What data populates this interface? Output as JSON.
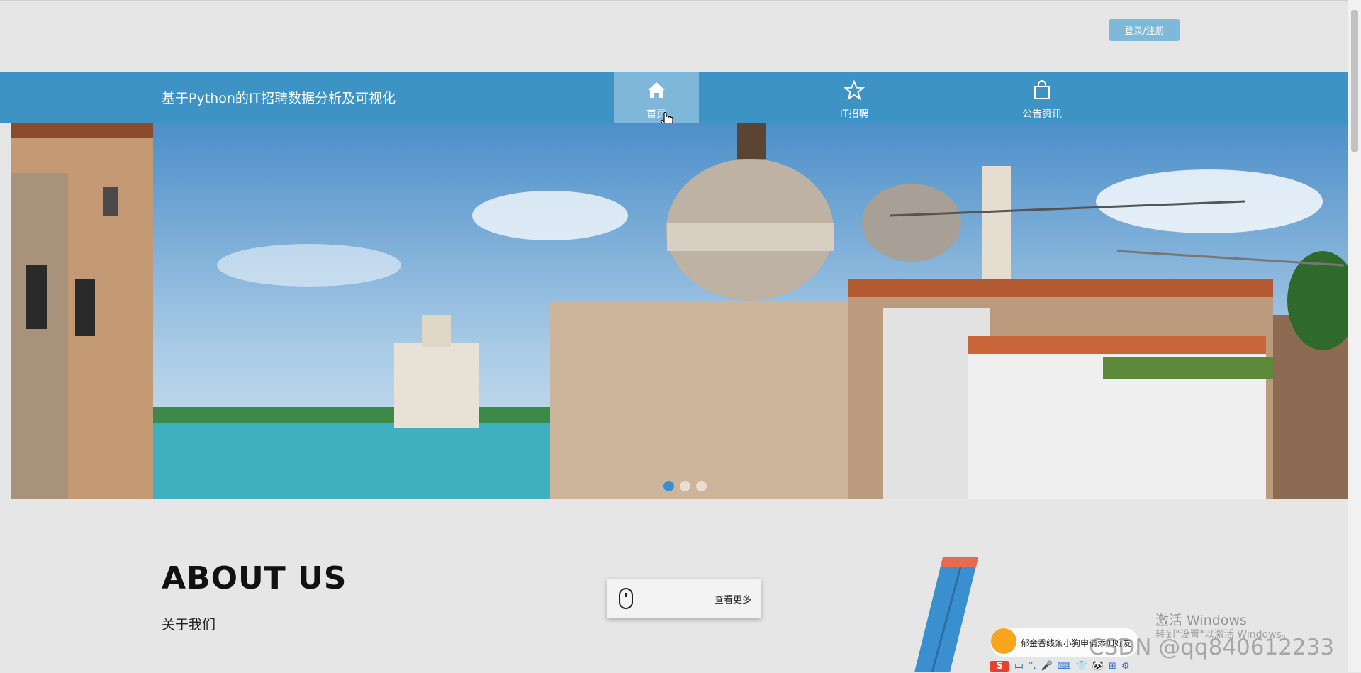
{
  "header": {
    "login_label": "登录/注册"
  },
  "nav": {
    "site_title": "基于Python的IT招聘数据分析及可视化",
    "items": [
      {
        "label": "首页",
        "icon": "home-icon",
        "active": true
      },
      {
        "label": "IT招聘",
        "icon": "star-icon",
        "active": false
      },
      {
        "label": "公告资讯",
        "icon": "shopping-bag-icon",
        "active": false
      }
    ]
  },
  "banner": {
    "slides": 3,
    "active_slide": 1
  },
  "about": {
    "title": "ABOUT US",
    "subtitle": "关于我们",
    "more_label": "查看更多"
  },
  "overlay": {
    "windows_title": "激活 Windows",
    "windows_sub": "转到\"设置\"以激活 Windows。",
    "csdn": "CSDN @qq840612233",
    "ime_tip": "郁金香线条小狗申请添加好友",
    "ime_bar": [
      "中",
      "°,",
      "🎤",
      "⌨",
      "👕",
      "🐼",
      "⊞",
      "⚙"
    ]
  },
  "colors": {
    "nav_bg": "#3d93c4",
    "nav_active": "#7eb7d9",
    "login_bg": "#7fb9da"
  }
}
